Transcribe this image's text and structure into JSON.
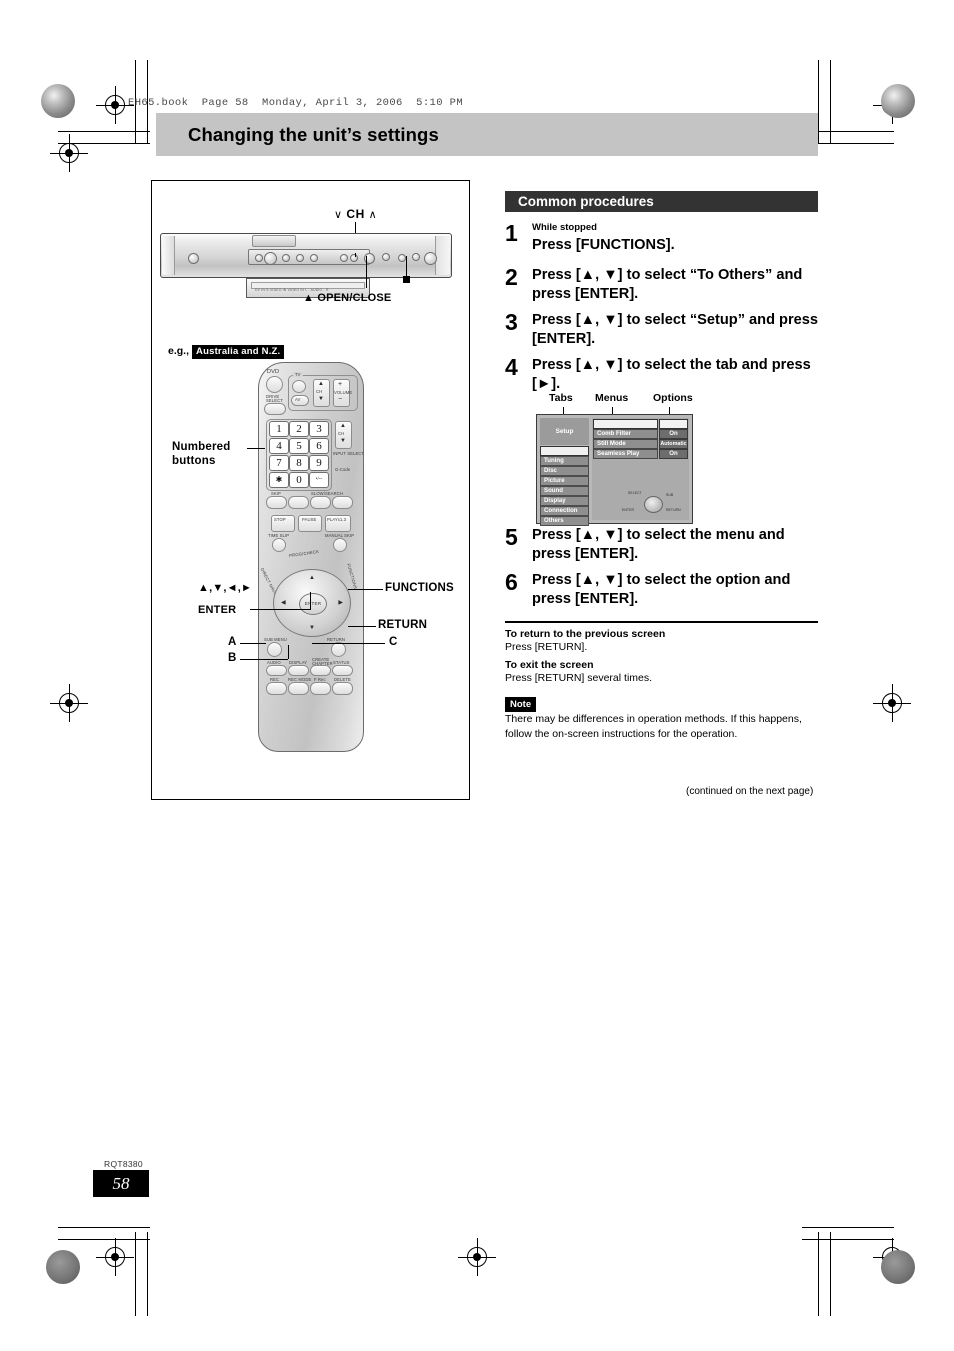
{
  "file_header": "EH65.book  Page 58  Monday, April 3, 2006  5:10 PM",
  "title": "Changing the unit’s settings",
  "left_panel": {
    "ch_label_down": "∨",
    "ch_label": "CH",
    "ch_label_up": "∧",
    "open_close": "▲ OPEN/CLOSE",
    "eg_prefix": "e.g.,",
    "eg_region": "Australia and N.Z.",
    "numbered_buttons_label": "Numbered\nbuttons",
    "numbered_line1": "Numbered",
    "numbered_line2": "buttons",
    "arrows_label": "▲,▼,◄,►",
    "enter_label": "ENTER",
    "functions_label": "FUNCTIONS",
    "return_label": "RETURN",
    "button_a": "A",
    "button_b": "B",
    "button_c": "C",
    "remote": {
      "dvd": "DVD",
      "tv": "TV",
      "drive_select": "DRIVE\nSELECT",
      "drive_select_l1": "DRIVE",
      "drive_select_l2": "SELECT",
      "av": "AV",
      "ch": "CH",
      "volume": "VOLUME",
      "input_select": "INPUT SELECT",
      "g_code": "G-Code",
      "slow_search": "SLOW/SEARCH",
      "skip": "SKIP",
      "stop": "STOP",
      "pause": "PAUSE",
      "play": "PLAYx1.3",
      "time_slip": "TIME SLIP",
      "manual_skip": "MANUAL SKIP",
      "prog_check": "PROG/CHECK",
      "direct_navigator": "DIRECT NAVIGATOR",
      "functions": "FUNCTIONS",
      "enter": "ENTER",
      "sub_menu": "SUB MENU",
      "return": "RETURN",
      "audio": "AUDIO",
      "display": "DISPLAY",
      "create_chapter": "CREATE\nCHAPTER",
      "create_chapter_l1": "CREATE",
      "create_chapter_l2": "CHAPTER",
      "status": "STATUS",
      "rec": "REC",
      "rec_mode": "REC MODE",
      "f_rec": "F Rec",
      "delete": "DELETE",
      "keys": [
        "1",
        "2",
        "3",
        "4",
        "5",
        "6",
        "7",
        "8",
        "9"
      ],
      "key_star": "✱",
      "key_zero": "0",
      "key_cancel": "•/--"
    }
  },
  "right_panel": {
    "section_title": "Common procedures",
    "steps": [
      {
        "num": "1",
        "pre": "While stopped",
        "text": "Press [FUNCTIONS]."
      },
      {
        "num": "2",
        "pre": "",
        "text": "Press [▲, ▼] to select “To Others” and press [ENTER]."
      },
      {
        "num": "3",
        "pre": "",
        "text": "Press [▲, ▼] to select “Setup” and press [ENTER]."
      },
      {
        "num": "4",
        "pre": "",
        "text": "Press [▲, ▼] to select the tab and press [►]."
      },
      {
        "num": "5",
        "pre": "",
        "text": "Press [▲, ▼] to select the menu and press [ENTER]."
      },
      {
        "num": "6",
        "pre": "",
        "text": "Press [▲, ▼] to select the option and press [ENTER]."
      }
    ],
    "osd": {
      "label_tabs": "Tabs",
      "label_menus": "Menus",
      "label_options": "Options",
      "header": "Setup",
      "tabs": [
        "",
        "Tuning",
        "Disc",
        "Picture",
        "Sound",
        "Display",
        "Connection",
        "Others"
      ],
      "rows": [
        {
          "name": "",
          "value": ""
        },
        {
          "name": "Comb Filter",
          "value": "On"
        },
        {
          "name": "Still Mode",
          "value": "Automatic"
        },
        {
          "name": "Seamless Play",
          "value": "On"
        }
      ],
      "guide_select": "SELECT",
      "guide_sub": "SUB",
      "guide_enter": "ENTER",
      "guide_return": "RETURN"
    },
    "return_heading": "To return to the previous screen",
    "return_body": "Press [RETURN].",
    "exit_heading": "To exit the screen",
    "exit_body": "Press [RETURN] several times.",
    "note_flag": "Note",
    "note_text": "There may be differences in operation methods. If this happens, follow the on-screen instructions for the operation.",
    "continued": "(continued on the next page)"
  },
  "footer": {
    "rqt": "RQT8380",
    "page": "58"
  }
}
